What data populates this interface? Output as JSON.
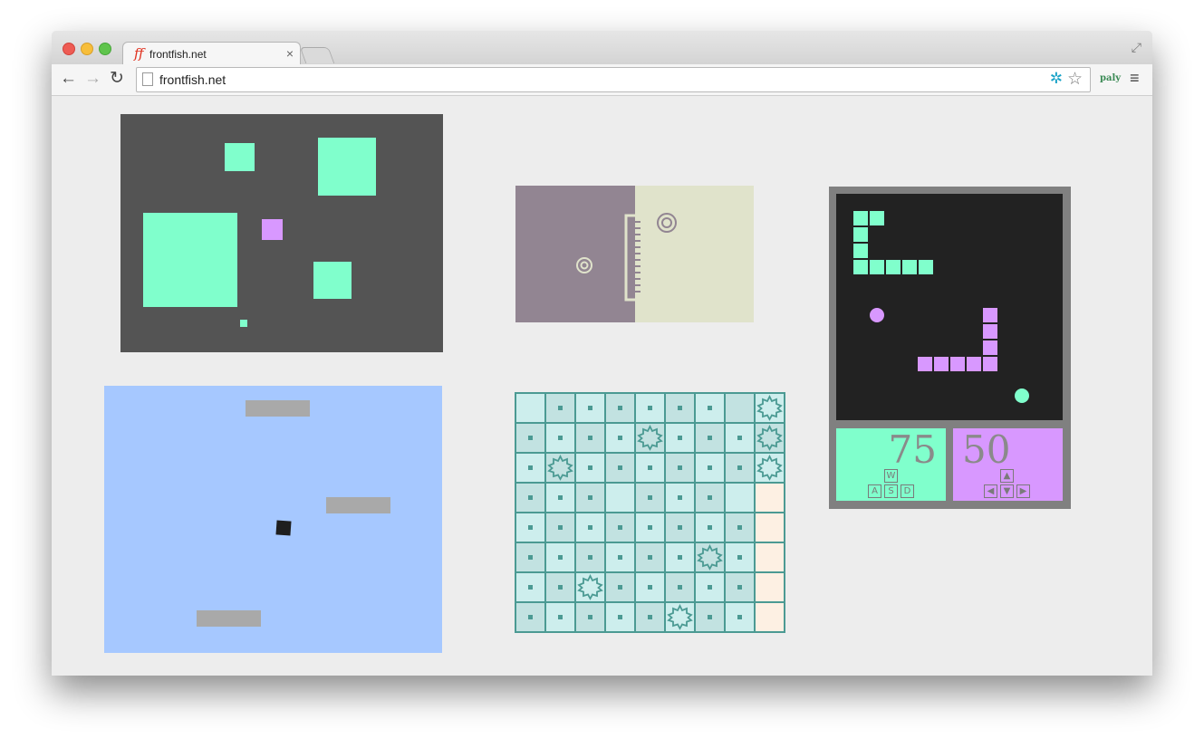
{
  "browser": {
    "tab_title": "frontfish.net",
    "tab_icon_text": "ff",
    "tab_close": "×",
    "url": "frontfish.net",
    "extension_label": "paly",
    "nav": {
      "back": "←",
      "forward": "→",
      "reload": "↻",
      "menu": "≡",
      "fullscreen": "⤢",
      "star": "☆",
      "ext": "✲"
    }
  },
  "colors": {
    "game1_bg": "#545454",
    "mint": "#80ffcc",
    "violet": "#d898ff",
    "game2_left": "#928592",
    "game2_right": "#e0e3cb",
    "game3_frame": "#808080",
    "game3_board": "#222222",
    "game4_bg": "#a6c8ff",
    "game4_platform": "#a9a9a9",
    "grid_line": "#4b9a93"
  },
  "games": {
    "snake": {
      "score_green": "75",
      "score_purple": "50",
      "keys_green": [
        "W",
        "A",
        "S",
        "D"
      ],
      "keys_purple": [
        "▲",
        "◀",
        "▼",
        "▶"
      ]
    },
    "grid": {
      "rows": 8,
      "cols": 9
    }
  }
}
